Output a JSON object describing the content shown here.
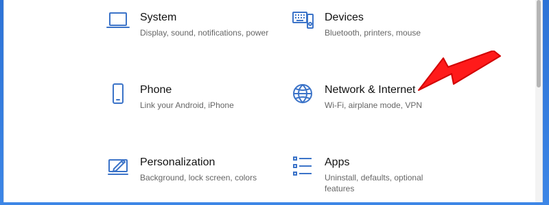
{
  "settings": {
    "items": [
      {
        "title": "System",
        "description": "Display, sound, notifications, power",
        "icon": "laptop-icon"
      },
      {
        "title": "Devices",
        "description": "Bluetooth, printers, mouse",
        "icon": "devices-icon"
      },
      {
        "title": "Phone",
        "description": "Link your Android, iPhone",
        "icon": "phone-icon"
      },
      {
        "title": "Network & Internet",
        "description": "Wi-Fi, airplane mode, VPN",
        "icon": "globe-icon"
      },
      {
        "title": "Personalization",
        "description": "Background, lock screen, colors",
        "icon": "personalization-icon"
      },
      {
        "title": "Apps",
        "description": "Uninstall, defaults, optional features",
        "icon": "apps-icon"
      }
    ]
  },
  "colors": {
    "accent": "#3b73c8",
    "annotation": "#ff1a1a",
    "text_primary": "#111111",
    "text_secondary": "#666666"
  },
  "annotation": {
    "icon": "red-arrow-icon"
  }
}
